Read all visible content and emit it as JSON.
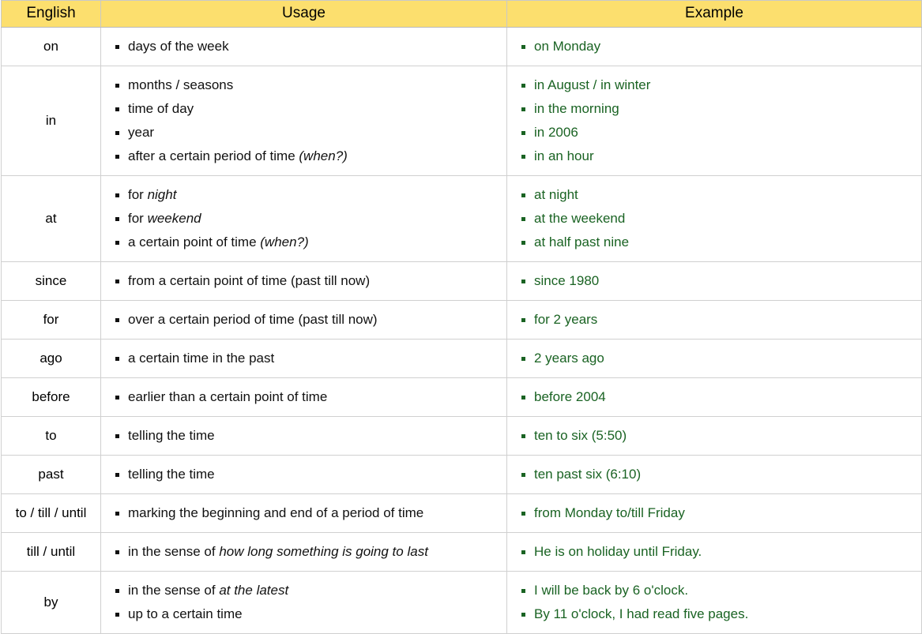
{
  "table": {
    "headers": {
      "english": "English",
      "usage": "Usage",
      "example": "Example"
    },
    "colors": {
      "header_background": "#fcdf6e",
      "example_text": "#1a6323",
      "usage_text": "#111111",
      "border": "#d0d0d0"
    },
    "rows": [
      {
        "english": "on",
        "usage": [
          {
            "text": "days of the week",
            "italic": ""
          }
        ],
        "example": [
          "on Monday"
        ]
      },
      {
        "english": "in",
        "usage": [
          {
            "text": "months / seasons",
            "italic": ""
          },
          {
            "text": "time of day",
            "italic": ""
          },
          {
            "text": "year",
            "italic": ""
          },
          {
            "text": "after a certain period of time ",
            "italic": "(when?)"
          }
        ],
        "example": [
          "in August / in winter",
          "in the morning",
          "in 2006",
          "in an hour"
        ]
      },
      {
        "english": "at",
        "usage": [
          {
            "text": "for ",
            "italic": "night"
          },
          {
            "text": "for ",
            "italic": "weekend"
          },
          {
            "text": "a certain point of time ",
            "italic": "(when?)"
          }
        ],
        "example": [
          "at night",
          "at the weekend",
          "at half past nine"
        ]
      },
      {
        "english": "since",
        "usage": [
          {
            "text": "from a certain point of time (past till now)",
            "italic": ""
          }
        ],
        "example": [
          "since 1980"
        ]
      },
      {
        "english": "for",
        "usage": [
          {
            "text": "over a certain period of time (past till now)",
            "italic": ""
          }
        ],
        "example": [
          "for 2 years"
        ]
      },
      {
        "english": "ago",
        "usage": [
          {
            "text": "a certain time in the past",
            "italic": ""
          }
        ],
        "example": [
          "2 years ago"
        ]
      },
      {
        "english": "before",
        "usage": [
          {
            "text": "earlier than a certain point of time",
            "italic": ""
          }
        ],
        "example": [
          "before 2004"
        ]
      },
      {
        "english": "to",
        "usage": [
          {
            "text": "telling the time",
            "italic": ""
          }
        ],
        "example": [
          "ten to six (5:50)"
        ]
      },
      {
        "english": "past",
        "usage": [
          {
            "text": "telling the time",
            "italic": ""
          }
        ],
        "example": [
          "ten past six (6:10)"
        ]
      },
      {
        "english": "to / till / until",
        "usage": [
          {
            "text": "marking the beginning and end of a period of time",
            "italic": ""
          }
        ],
        "example": [
          "from Monday to/till Friday"
        ]
      },
      {
        "english": "till / until",
        "usage": [
          {
            "text": "in the sense of ",
            "italic": "how long something is going to last"
          }
        ],
        "example": [
          "He is on holiday until Friday."
        ]
      },
      {
        "english": "by",
        "usage": [
          {
            "text": "in the sense of ",
            "italic": "at the latest"
          },
          {
            "text": "up to a certain time",
            "italic": ""
          }
        ],
        "example": [
          "I will be back by 6 o'clock.",
          "By 11 o'clock, I had read five pages."
        ]
      }
    ]
  }
}
